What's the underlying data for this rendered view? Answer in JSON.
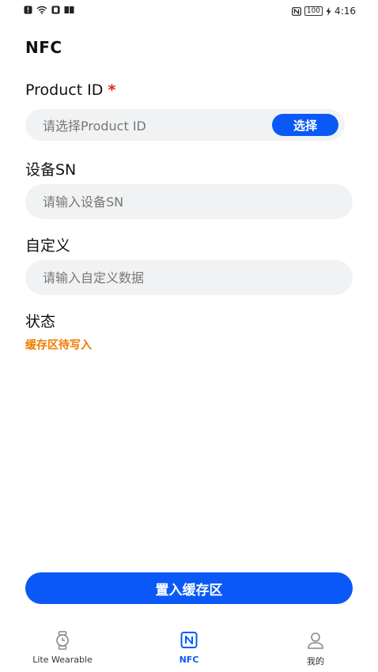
{
  "status_bar": {
    "time": "4:16",
    "battery": "100",
    "icons": [
      "notification-icon",
      "wifi-icon",
      "sim-icon",
      "book-icon",
      "nfc-status-icon",
      "charging-icon"
    ]
  },
  "page": {
    "title": "NFC"
  },
  "fields": {
    "product_id": {
      "label": "Product ID",
      "required_mark": "*",
      "placeholder": "请选择Product ID",
      "button_label": "选择"
    },
    "device_sn": {
      "label": "设备SN",
      "placeholder": "请输入设备SN"
    },
    "custom": {
      "label": "自定义",
      "placeholder": "请输入自定义数据"
    }
  },
  "status": {
    "label": "状态",
    "value": "缓存区待写入",
    "value_color": "#ef7b00"
  },
  "actions": {
    "primary_label": "置入缓存区"
  },
  "tabs": [
    {
      "label": "Lite Wearable",
      "icon": "watch-icon",
      "active": false
    },
    {
      "label": "NFC",
      "icon": "nfc-icon",
      "active": true
    },
    {
      "label": "我的",
      "icon": "person-icon",
      "active": false
    }
  ],
  "colors": {
    "accent": "#0a59f7",
    "input_bg": "#f1f2f3"
  }
}
